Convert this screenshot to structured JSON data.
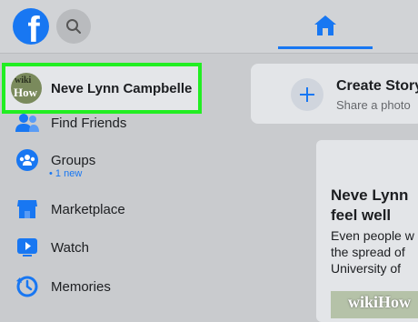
{
  "topbar": {
    "logo_letter": "f",
    "logo_color": "#1877f2",
    "icons": [
      "facebook-logo",
      "search-icon",
      "home-icon"
    ]
  },
  "sidebar": {
    "profile": {
      "name": "Neve Lynn Campbelle",
      "avatar_text_top": "wiki",
      "avatar_text_bottom": "How",
      "highlight_color": "#22ee22"
    },
    "items": [
      {
        "label": "Find Friends",
        "icon": "friends-icon"
      },
      {
        "label": "Groups",
        "icon": "groups-icon",
        "sub": "• 1 new"
      },
      {
        "label": "Marketplace",
        "icon": "marketplace-icon"
      },
      {
        "label": "Watch",
        "icon": "watch-icon"
      },
      {
        "label": "Memories",
        "icon": "memories-icon"
      }
    ]
  },
  "main": {
    "create_story": {
      "title": "Create Story",
      "subtitle": "Share a photo"
    },
    "news_card": {
      "title_lines": [
        "Neve Lynn",
        "feel well"
      ],
      "body_lines": [
        "Even people w",
        "the spread of",
        "University of"
      ]
    }
  },
  "watermark": "wikiHow"
}
